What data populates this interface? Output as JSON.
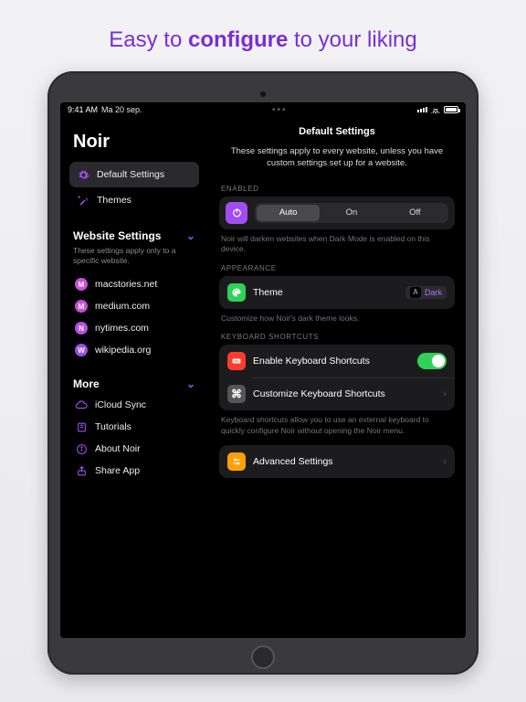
{
  "headline": {
    "pre": "Easy to ",
    "bold": "configure",
    "post": " to your liking"
  },
  "status": {
    "time": "9:41 AM",
    "date": "Ma 20 sep."
  },
  "app": {
    "title": "Noir"
  },
  "sidebar": {
    "primary": [
      {
        "label": "Default Settings",
        "icon": "gear-icon",
        "active": true
      },
      {
        "label": "Themes",
        "icon": "wand-icon",
        "active": false
      }
    ],
    "website": {
      "header": "Website Settings",
      "desc": "These settings apply only to a specific website.",
      "sites": [
        {
          "letter": "M",
          "color": "#c84fd9",
          "label": "macstories.net"
        },
        {
          "letter": "M",
          "color": "#c84fd9",
          "label": "medium.com"
        },
        {
          "letter": "N",
          "color": "#b84fe0",
          "label": "nytimes.com"
        },
        {
          "letter": "W",
          "color": "#9a4fe6",
          "label": "wikipedia.org"
        }
      ]
    },
    "more": {
      "header": "More",
      "items": [
        {
          "label": "iCloud Sync",
          "icon": "cloud-icon"
        },
        {
          "label": "Tutorials",
          "icon": "book-icon"
        },
        {
          "label": "About Noir",
          "icon": "info-icon"
        },
        {
          "label": "Share App",
          "icon": "share-icon"
        }
      ]
    }
  },
  "main": {
    "title": "Default Settings",
    "intro": "These settings apply to every website, unless you have custom settings set up for a website.",
    "enabled": {
      "label": "ENABLED",
      "options": [
        "Auto",
        "On",
        "Off"
      ],
      "selected": "Auto",
      "help": "Noir will darken websites when Dark Mode is enabled on this device."
    },
    "appearance": {
      "label": "APPEARANCE",
      "theme_row": "Theme",
      "theme_value": "Dark",
      "help": "Customize how Noir's dark theme looks."
    },
    "keyboard": {
      "label": "KEYBOARD SHORTCUTS",
      "enable_row": "Enable Keyboard Shortcuts",
      "customize_row": "Customize Keyboard Shortcuts",
      "help": "Keyboard shortcuts allow you to use an external keyboard to quickly configure Noir without opening the Noir menu."
    },
    "advanced": {
      "row": "Advanced Settings"
    }
  }
}
